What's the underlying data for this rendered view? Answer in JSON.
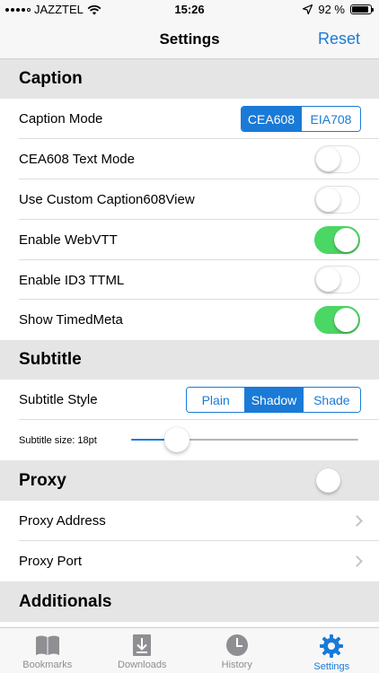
{
  "status": {
    "carrier": "JAZZTEL",
    "time": "15:26",
    "battery": "92 %",
    "battery_level": 0.92
  },
  "nav": {
    "title": "Settings",
    "reset": "Reset"
  },
  "caption": {
    "header": "Caption",
    "mode_label": "Caption Mode",
    "mode_options": [
      "CEA608",
      "EIA708"
    ],
    "mode_selected": "CEA608",
    "toggles": [
      {
        "label": "CEA608 Text Mode",
        "on": false
      },
      {
        "label": "Use Custom Caption608View",
        "on": false
      },
      {
        "label": "Enable WebVTT",
        "on": true
      },
      {
        "label": "Enable ID3 TTML",
        "on": false
      },
      {
        "label": "Show TimedMeta",
        "on": true
      }
    ]
  },
  "subtitle": {
    "header": "Subtitle",
    "style_label": "Subtitle Style",
    "style_options": [
      "Plain",
      "Shadow",
      "Shade"
    ],
    "style_selected": "Shadow",
    "size_label": "Subtitle size: 18pt",
    "size_fraction": 0.2
  },
  "proxy": {
    "header": "Proxy",
    "enabled": false,
    "address_label": "Proxy Address",
    "port_label": "Proxy Port"
  },
  "additionals": {
    "header": "Additionals"
  },
  "tabs": [
    {
      "label": "Bookmarks",
      "icon": "bookmarks-icon",
      "active": false
    },
    {
      "label": "Downloads",
      "icon": "downloads-icon",
      "active": false
    },
    {
      "label": "History",
      "icon": "history-icon",
      "active": false
    },
    {
      "label": "Settings",
      "icon": "gear-icon",
      "active": true
    }
  ],
  "colors": {
    "accent": "#1a7ad7",
    "toggle_on": "#4bd763",
    "section_bg": "#e5e5e5"
  }
}
